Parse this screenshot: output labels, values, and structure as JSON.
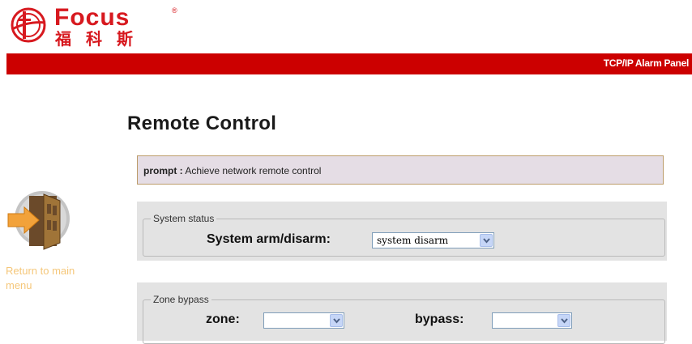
{
  "brand": {
    "name": "Focus",
    "registered": "®",
    "chinese": "福科斯"
  },
  "header": {
    "title": "TCP/IP Alarm Panel"
  },
  "sidebar": {
    "return_label": "Return to main menu"
  },
  "page": {
    "title": "Remote Control"
  },
  "prompt": {
    "label": "prompt :",
    "text": "Achieve network remote control"
  },
  "system_status": {
    "legend": "System status",
    "arm_label": "System arm/disarm:",
    "arm_value": "system disarm"
  },
  "zone_bypass": {
    "legend": "Zone bypass",
    "zone_label": "zone:",
    "zone_value": "",
    "bypass_label": "bypass:",
    "bypass_value": ""
  },
  "colors": {
    "brand_red": "#d7191f",
    "header_bar": "#cc0000",
    "prompt_bg": "#e5dde5",
    "panel_bg": "#e3e3e3",
    "link": "#f5c77a"
  }
}
